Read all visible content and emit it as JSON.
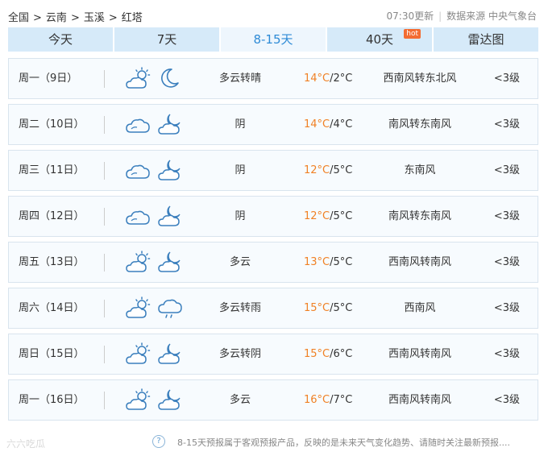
{
  "header": {
    "breadcrumbs": [
      "全国",
      "云南",
      "玉溪",
      "红塔"
    ],
    "separator": ">",
    "update_time": "07:30更新",
    "source": "数据来源 中央气象台"
  },
  "tabs": [
    {
      "label": "今天",
      "active": false
    },
    {
      "label": "7天",
      "active": false
    },
    {
      "label": "8-15天",
      "active": true
    },
    {
      "label": "40天",
      "active": false,
      "badge": "hot"
    },
    {
      "label": "雷达图",
      "active": false
    }
  ],
  "forecast": [
    {
      "day": "周一（9日）",
      "icon_day": "partly-cloudy-sun-icon",
      "icon_night": "moon-icon",
      "weather": "多云转晴",
      "high": "14°C",
      "low": "/2°C",
      "wind": "西南风转东北风",
      "level": "<3级"
    },
    {
      "day": "周二（10日）",
      "icon_day": "cloud-icon",
      "icon_night": "cloud-moon-icon",
      "weather": "阴",
      "high": "14°C",
      "low": "/4°C",
      "wind": "南风转东南风",
      "level": "<3级"
    },
    {
      "day": "周三（11日）",
      "icon_day": "cloud-icon",
      "icon_night": "cloud-moon-icon",
      "weather": "阴",
      "high": "12°C",
      "low": "/5°C",
      "wind": "东南风",
      "level": "<3级"
    },
    {
      "day": "周四（12日）",
      "icon_day": "cloud-icon",
      "icon_night": "cloud-moon-icon",
      "weather": "阴",
      "high": "12°C",
      "low": "/5°C",
      "wind": "南风转东南风",
      "level": "<3级"
    },
    {
      "day": "周五（13日）",
      "icon_day": "partly-cloudy-sun-icon",
      "icon_night": "cloud-moon-icon",
      "weather": "多云",
      "high": "13°C",
      "low": "/5°C",
      "wind": "西南风转南风",
      "level": "<3级"
    },
    {
      "day": "周六（14日）",
      "icon_day": "partly-cloudy-sun-icon",
      "icon_night": "rain-cloud-icon",
      "weather": "多云转雨",
      "high": "15°C",
      "low": "/5°C",
      "wind": "西南风",
      "level": "<3级"
    },
    {
      "day": "周日（15日）",
      "icon_day": "partly-cloudy-sun-icon",
      "icon_night": "cloud-moon-icon",
      "weather": "多云转阴",
      "high": "15°C",
      "low": "/6°C",
      "wind": "西南风转南风",
      "level": "<3级"
    },
    {
      "day": "周一（16日）",
      "icon_day": "partly-cloudy-sun-icon",
      "icon_night": "cloud-moon-icon",
      "weather": "多云",
      "high": "16°C",
      "low": "/7°C",
      "wind": "西南风转南风",
      "level": "<3级"
    }
  ],
  "footer": {
    "help_icon": "?",
    "note": "8-15天预报属于客观预报产品，反映的是未来天气变化趋势、请随时关注最新预报....",
    "watermark": "六六吃瓜"
  },
  "colors": {
    "accent": "#2e8bd6",
    "high_temp": "#f08125",
    "tab_bg": "#d6eaf9",
    "row_bg": "#f7fbfe",
    "icon_stroke": "#3b7fbd"
  }
}
